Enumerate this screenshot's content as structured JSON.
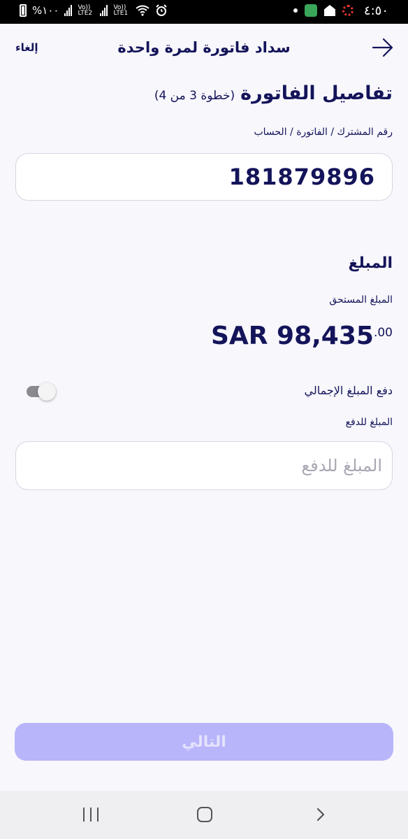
{
  "status_bar": {
    "time": "٤:٥٠",
    "battery": "%١٠٠",
    "sim1_label": "Vo)) LTE2",
    "sim2_label": "Vo)) LTE1"
  },
  "header": {
    "title": "سداد فاتورة لمرة واحدة",
    "cancel_label": "إلغاء",
    "back_icon": "arrow-right-icon"
  },
  "details": {
    "title": "تفاصيل الفاتورة",
    "step": "(خطوة 3 من 4)",
    "account_label": "رقم المشترك / الفاتورة / الحساب",
    "account_value": "181879896"
  },
  "amount": {
    "title": "المبلغ",
    "due_label": "المبلغ المستحق",
    "due_main": "SAR 98,435",
    "due_cents": ".00",
    "pay_full_label": "دفع المبلغ الإجمالي",
    "pay_full_on": false,
    "pay_label": "المبلغ للدفع",
    "pay_placeholder": "المبلغ للدفع",
    "pay_value": ""
  },
  "footer": {
    "next_label": "التالي"
  },
  "colors": {
    "primary_text": "#14145a",
    "button_disabled": "#b8b5fb",
    "background": "#f7f7fc"
  }
}
